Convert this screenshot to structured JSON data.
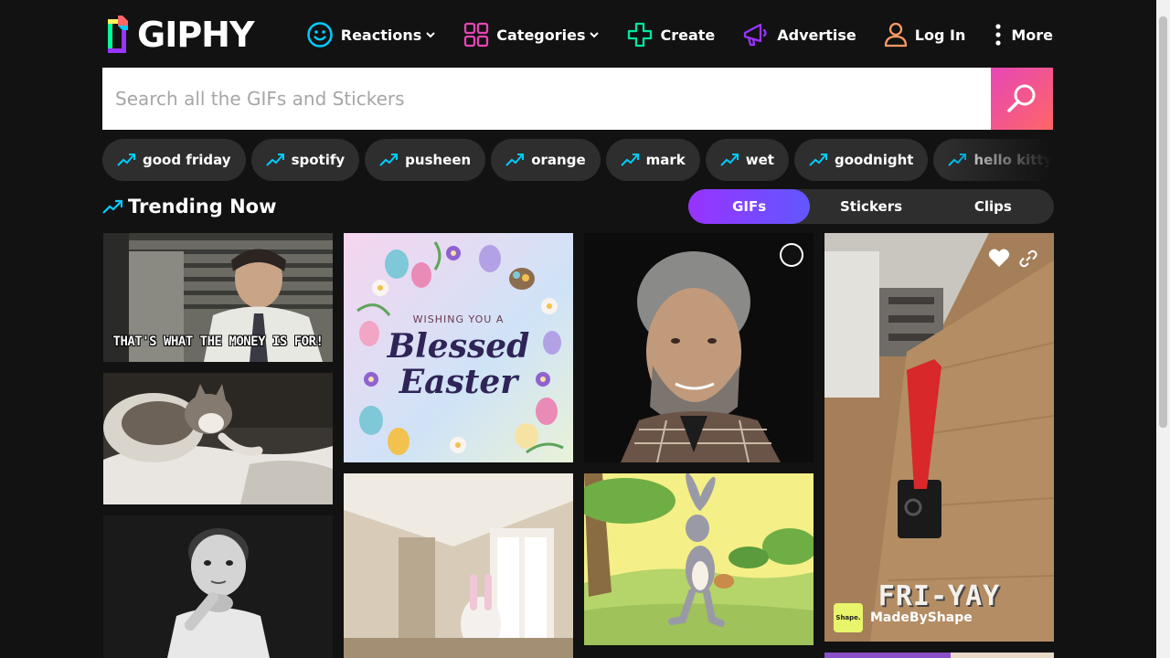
{
  "header": {
    "brand": "GIPHY",
    "nav": [
      {
        "label": "Reactions",
        "icon": "smiley-icon",
        "dropdown": true
      },
      {
        "label": "Categories",
        "icon": "grid-icon",
        "dropdown": true
      },
      {
        "label": "Create",
        "icon": "plus-icon",
        "dropdown": false
      },
      {
        "label": "Advertise",
        "icon": "megaphone-icon",
        "dropdown": false
      },
      {
        "label": "Log In",
        "icon": "user-icon",
        "dropdown": false
      },
      {
        "label": "More",
        "icon": "kebab-icon",
        "dropdown": false
      }
    ]
  },
  "search": {
    "placeholder": "Search all the GIFs and Stickers",
    "value": ""
  },
  "trending_tags": [
    "good friday",
    "spotify",
    "pusheen",
    "orange",
    "mark",
    "wet",
    "goodnight",
    "hello kitty"
  ],
  "section": {
    "title": "Trending Now",
    "tabs": [
      {
        "label": "GIFs",
        "active": true
      },
      {
        "label": "Stickers",
        "active": false
      },
      {
        "label": "Clips",
        "active": false
      }
    ]
  },
  "tiles": {
    "mad_men": {
      "caption": "THAT'S WHAT THE MONEY IS FOR!"
    },
    "easter_card": {
      "line1": "WISHING YOU A",
      "line2": "Blessed",
      "line3": "Easter"
    },
    "bunny_video": {
      "line1": "FRI-YAY",
      "creator": "MadeByShape",
      "creator_badge": "Shape."
    }
  },
  "colors": {
    "background": "#121212",
    "accent_pink": "#e646b6",
    "accent_purple": "#9933ff",
    "trend_cyan": "#00ccff"
  }
}
